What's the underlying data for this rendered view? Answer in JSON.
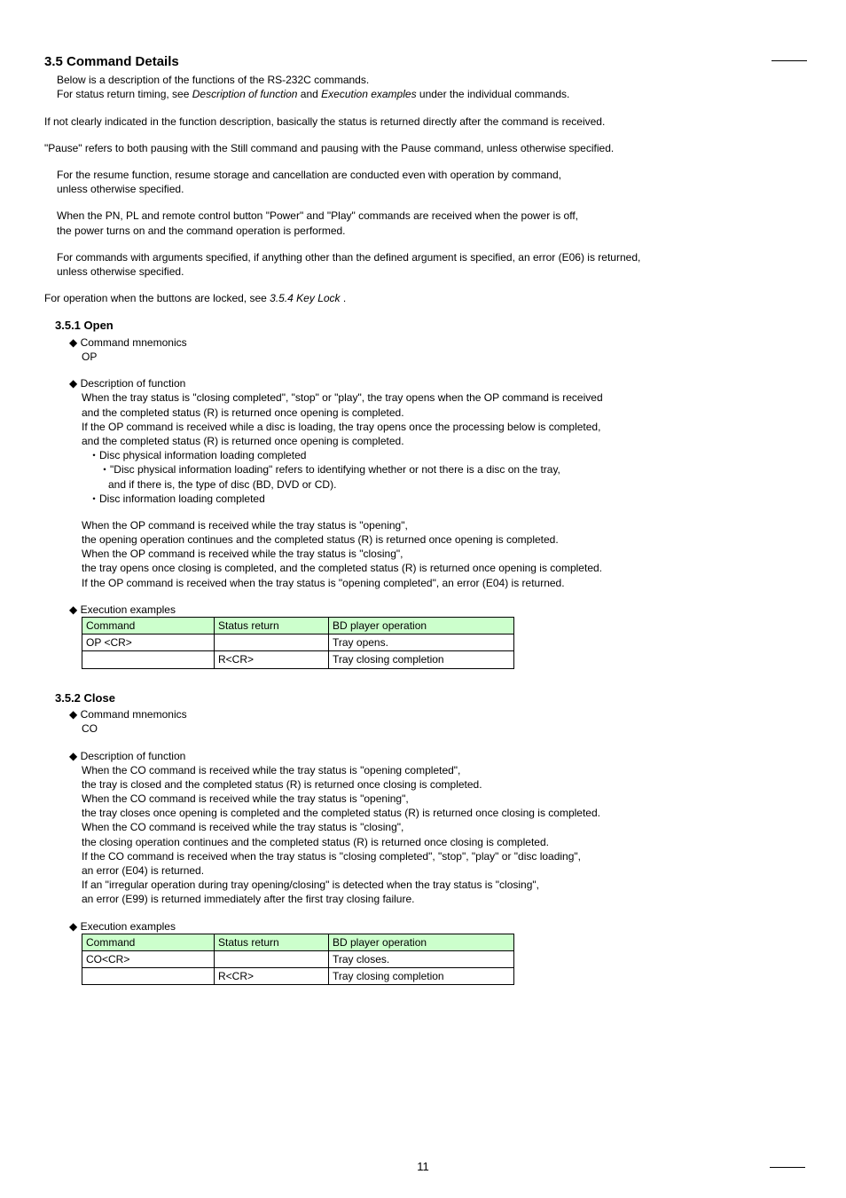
{
  "heading": "3.5 Command Details",
  "intro1a": "Below is a description of the functions of the RS-232C commands.",
  "intro1b_pre": "For status return timing, see ",
  "intro1b_i1": "Description of function",
  "intro1b_mid": " and ",
  "intro1b_i2": "Execution examples",
  "intro1b_post": " under the individual commands.",
  "p2": "If not clearly indicated in the function description, basically the status is returned directly after the command is received.",
  "p3": "\"Pause\" refers to both pausing with the Still command and pausing with the Pause command, unless otherwise specified.",
  "p4a": "For the resume function, resume storage and cancellation are conducted even with operation by command,",
  "p4b": "unless otherwise specified.",
  "p5a": "When the PN, PL and remote control button \"Power\" and \"Play\" commands are received when the power is off,",
  "p5b": "the power turns on and the command operation is performed.",
  "p6a": "For commands with arguments specified, if anything other than the defined argument is specified, an error (E06) is returned,",
  "p6b": "unless otherwise specified.",
  "p7_pre": "For operation when the buttons are locked, see ",
  "p7_i": "3.5.4 Key Lock",
  "p7_post": " .",
  "open_heading": "3.5.1 Open",
  "diamond_cmd": "◆ Command mnemonics",
  "open_mn": "OP",
  "diamond_desc": "◆ Description of function",
  "open_d1": "When the tray status is \"closing completed\", \"stop\" or \"play\", the tray opens when the OP command is received",
  "open_d2": "and the completed status (R) is returned once opening is completed.",
  "open_d3": "If the OP command is received while a disc is loading, the tray opens once the processing below is completed,",
  "open_d4": "and the completed status (R) is returned once opening is completed.",
  "open_b1": "Disc physical information loading completed",
  "open_b1_sub1": "\"Disc physical information loading\" refers to identifying whether or not there is a disc on the tray,",
  "open_b1_sub2": "and if there is, the type of disc (BD, DVD or CD).",
  "open_b2": "Disc information loading completed",
  "open_d5": "When the OP command is received while the tray status is \"opening\",",
  "open_d6": "the opening operation continues and the completed status (R) is returned once opening is completed.",
  "open_d7": "When the OP command is received while the tray status is \"closing\",",
  "open_d8": "the tray opens once closing is completed, and the completed status (R) is returned once opening is completed.",
  "open_d9": "If the OP command is received when the tray status is \"opening completed\", an error (E04) is returned.",
  "diamond_ex": "◆ Execution examples",
  "th_cmd": "Command",
  "th_stat": "Status return",
  "th_op": "BD player operation",
  "open_r1c1": "OP <CR>",
  "open_r1c2": "",
  "open_r1c3": "Tray opens.",
  "open_r2c1": "",
  "open_r2c2": "R<CR>",
  "open_r2c3": "Tray closing completion",
  "close_heading": "3.5.2 Close",
  "close_mn": "CO",
  "close_d1": "When the CO command is received while the tray status is \"opening completed\",",
  "close_d2": "the tray is closed and the completed status (R) is returned once closing is completed.",
  "close_d3": "When the CO command is received while the tray status is \"opening\",",
  "close_d4": "the tray closes once opening is completed and the completed status (R) is returned once closing is completed.",
  "close_d5": "When the CO command is received while the tray status is \"closing\",",
  "close_d6": "the closing operation continues and the completed status (R) is returned once closing is completed.",
  "close_d7": "If the CO command is received when the tray status is \"closing completed\", \"stop\", \"play\" or \"disc loading\",",
  "close_d8": "an error (E04) is returned.",
  "close_d9": "If an \"irregular operation during tray opening/closing\" is detected when the tray status is \"closing\",",
  "close_d10": "an error (E99) is returned immediately after the first tray closing failure.",
  "close_r1c1": "CO<CR>",
  "close_r1c2": "",
  "close_r1c3": "Tray closes.",
  "close_r2c1": "",
  "close_r2c2": "R<CR>",
  "close_r2c3": "Tray closing completion",
  "page_num": "11"
}
